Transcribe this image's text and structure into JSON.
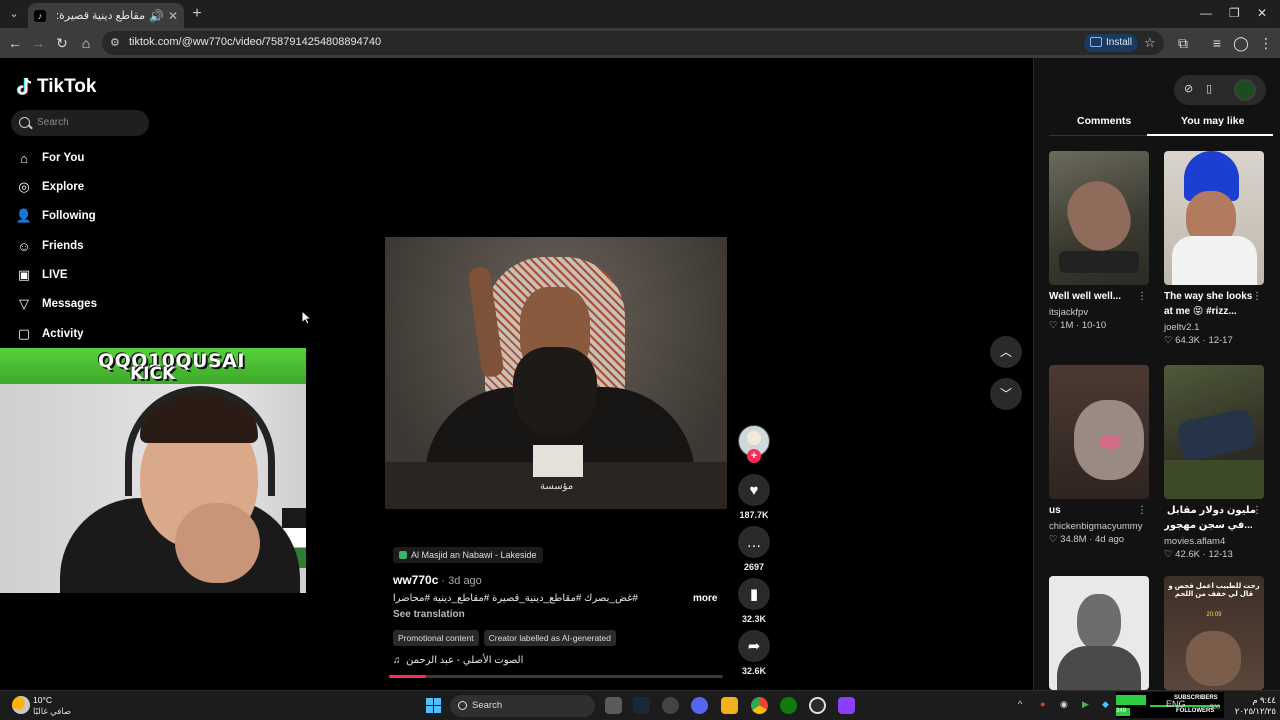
{
  "browser": {
    "tab_title": "مقاطع دينية قصيرة: نصائح و...",
    "url": "tiktok.com/@ww770c/video/7587914254808894740",
    "install_label": "Install"
  },
  "tiktok": {
    "logo_text": "TikTok",
    "search_placeholder": "Search",
    "nav": [
      {
        "label": "For You",
        "icon": "home-icon"
      },
      {
        "label": "Explore",
        "icon": "compass-icon"
      },
      {
        "label": "Following",
        "icon": "following-icon"
      },
      {
        "label": "Friends",
        "icon": "friends-icon"
      },
      {
        "label": "LIVE",
        "icon": "live-icon"
      },
      {
        "label": "Messages",
        "icon": "messages-icon"
      },
      {
        "label": "Activity",
        "icon": "activity-icon"
      }
    ],
    "webcam_banner_line1": "QQQ10QUSAI",
    "webcam_banner_line2": "KICK",
    "video": {
      "watermark": "مؤسسة",
      "location": "Al Masjid an Nabawi - Lakeside",
      "author": "ww770c",
      "posted": " · 3d ago",
      "description": "#غض_بصرك #مقاطع_دينية_قصيرة #مقاطع_دينية #محاضرات ...",
      "more_label": "more",
      "see_translation": "See translation",
      "tags": [
        "Promotional content",
        "Creator labelled as AI-generated"
      ],
      "music": "الصوت الأصلي - عبد الرحمن",
      "progress": 0.11,
      "likes": "187.7K",
      "comments": "2697",
      "saves": "32.3K",
      "shares": "32.6K"
    },
    "right_panel": {
      "tabs": [
        "Comments",
        "You may like"
      ],
      "active_tab": "You may like",
      "cards": [
        {
          "title": "Well well well...",
          "title2": "",
          "user": "itsjackfpv",
          "likes": "1M",
          "date": "10-10"
        },
        {
          "title": "The way she looks",
          "title2": "at me 😝 #rizz...",
          "user": "joeltv2.1",
          "likes": "64.3K",
          "date": "12-17"
        },
        {
          "title": "us",
          "title2": "",
          "user": "chickenbigmacyummy",
          "likes": "34.8M",
          "date": "4d ago"
        },
        {
          "title": "مليون دولار مقابل الاختباء",
          "title2": "...في سجن مهجور",
          "user": "movies.aflam4",
          "likes": "42.6K",
          "date": "12-13"
        },
        {
          "title": "",
          "title2": "",
          "user": "",
          "likes": "",
          "date": ""
        },
        {
          "title": "",
          "title2": "",
          "user": "",
          "likes": "",
          "date": "",
          "thumb_text": "رحت للطبيب اعمل فحص و قال لي خفف من اللحم",
          "thumb_price": "20:09"
        }
      ]
    }
  },
  "taskbar": {
    "temp": "10°C",
    "weather": "صافي غالبًا",
    "search_label": "Search",
    "lang": "ENG",
    "subscribers_label": "SUBSCRIBERS",
    "followers_label": "FOLLOWERS",
    "sub_count": "349",
    "fol_count": "500",
    "time": "٩:٤٤ م",
    "date": "٢٠٢٥/١٢/٢٥"
  }
}
